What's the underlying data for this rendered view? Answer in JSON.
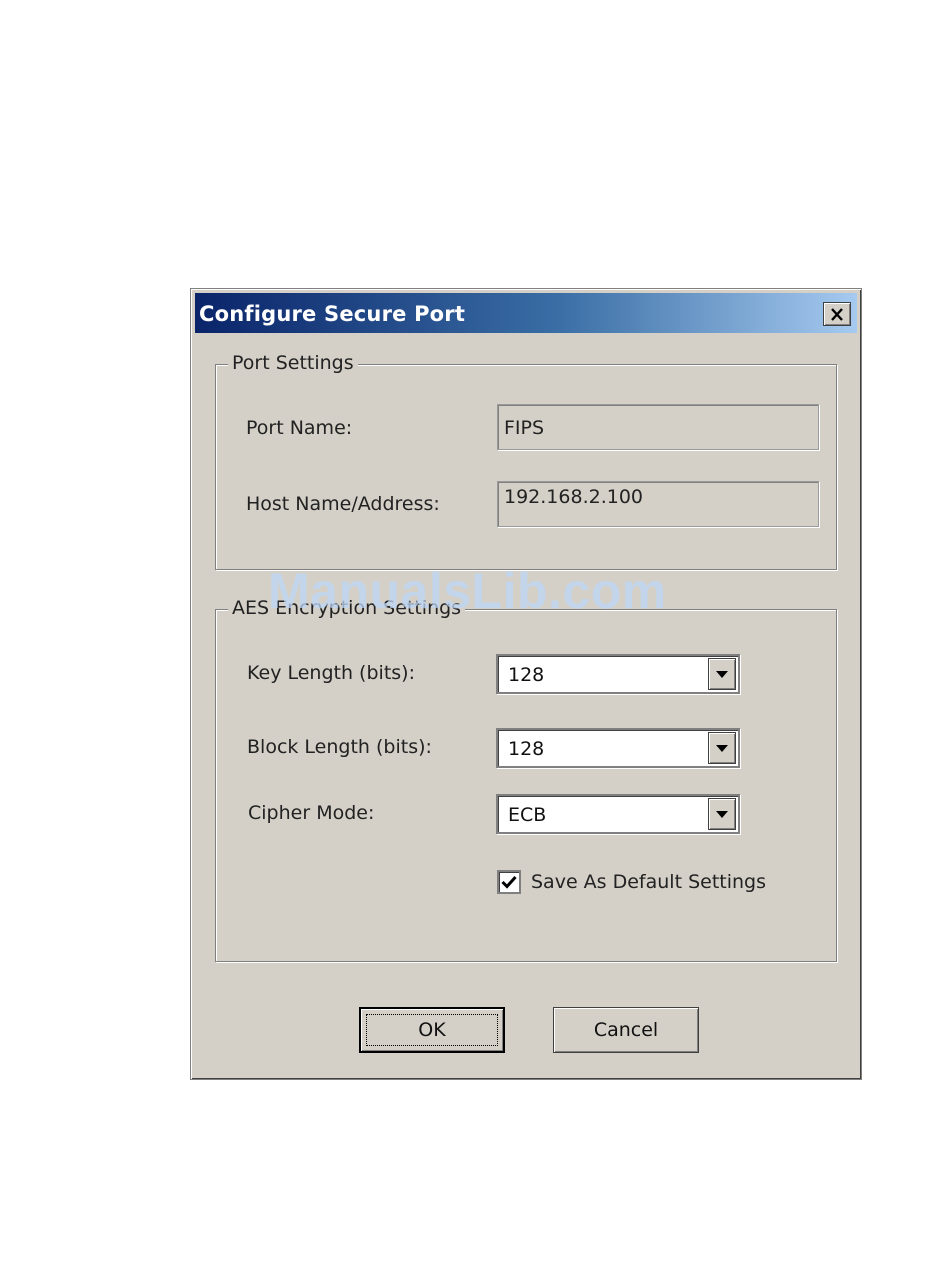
{
  "window": {
    "title": "Configure Secure Port"
  },
  "port_settings": {
    "group_label": "Port Settings",
    "port_name_label": "Port Name:",
    "port_name_value": "FIPS",
    "host_label": "Host Name/Address:",
    "host_value": "192.168.2.100"
  },
  "aes_settings": {
    "group_label": "AES Encryption Settings",
    "key_length_label": "Key Length (bits):",
    "key_length_value": "128",
    "block_length_label": "Block Length (bits):",
    "block_length_value": "128",
    "cipher_mode_label": "Cipher Mode:",
    "cipher_mode_value": "ECB",
    "save_default_label": "Save As Default Settings",
    "save_default_checked": true
  },
  "buttons": {
    "ok_label": "OK",
    "cancel_label": "Cancel"
  },
  "watermark": "ManualsLib.com",
  "icons": {
    "close": "close-icon",
    "dropdown": "chevron-down-icon",
    "check": "checkmark-icon"
  }
}
